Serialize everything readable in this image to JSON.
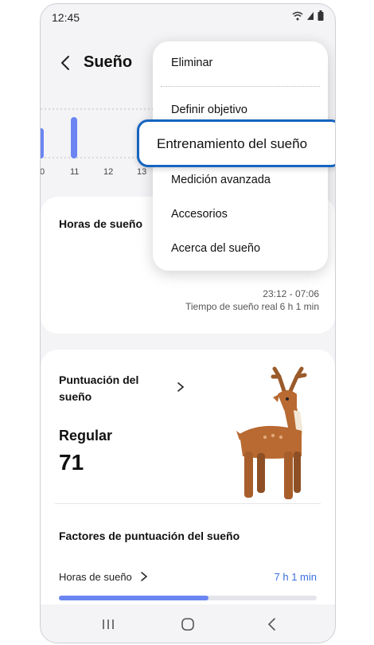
{
  "status": {
    "time": "12:45"
  },
  "header": {
    "title": "Sueño"
  },
  "chart": {
    "ticks": [
      "0",
      "11",
      "12",
      "13"
    ]
  },
  "card_hours": {
    "title": "Horas de sueño",
    "time_range": "23:12 - 07:06",
    "real_label": "Tiempo de sueño real",
    "real_value": "6 h 1 min"
  },
  "card_score": {
    "title_line1": "Puntuación del",
    "title_line2": "sueño",
    "rating": "Regular",
    "score": "71",
    "factors_title": "Factores de puntuación del sueño",
    "factor_label": "Horas de sueño",
    "factor_value": "7 h 1 min",
    "factor_progress": 0.58
  },
  "menu": {
    "items": [
      "Eliminar",
      "Definir objetivo",
      "Entrenamiento del sueño",
      "Medición avanzada",
      "Accesorios",
      "Acerca del sueño"
    ]
  },
  "colors": {
    "accent": "#1565c0",
    "bar": "#6b86f2",
    "value_blue": "#3b6fe0"
  },
  "icons": [
    "back-icon",
    "wifi-icon",
    "signal-icon",
    "battery-icon",
    "chevron-right-icon",
    "deer-illustration",
    "recent-apps-icon",
    "home-icon",
    "nav-back-icon"
  ]
}
